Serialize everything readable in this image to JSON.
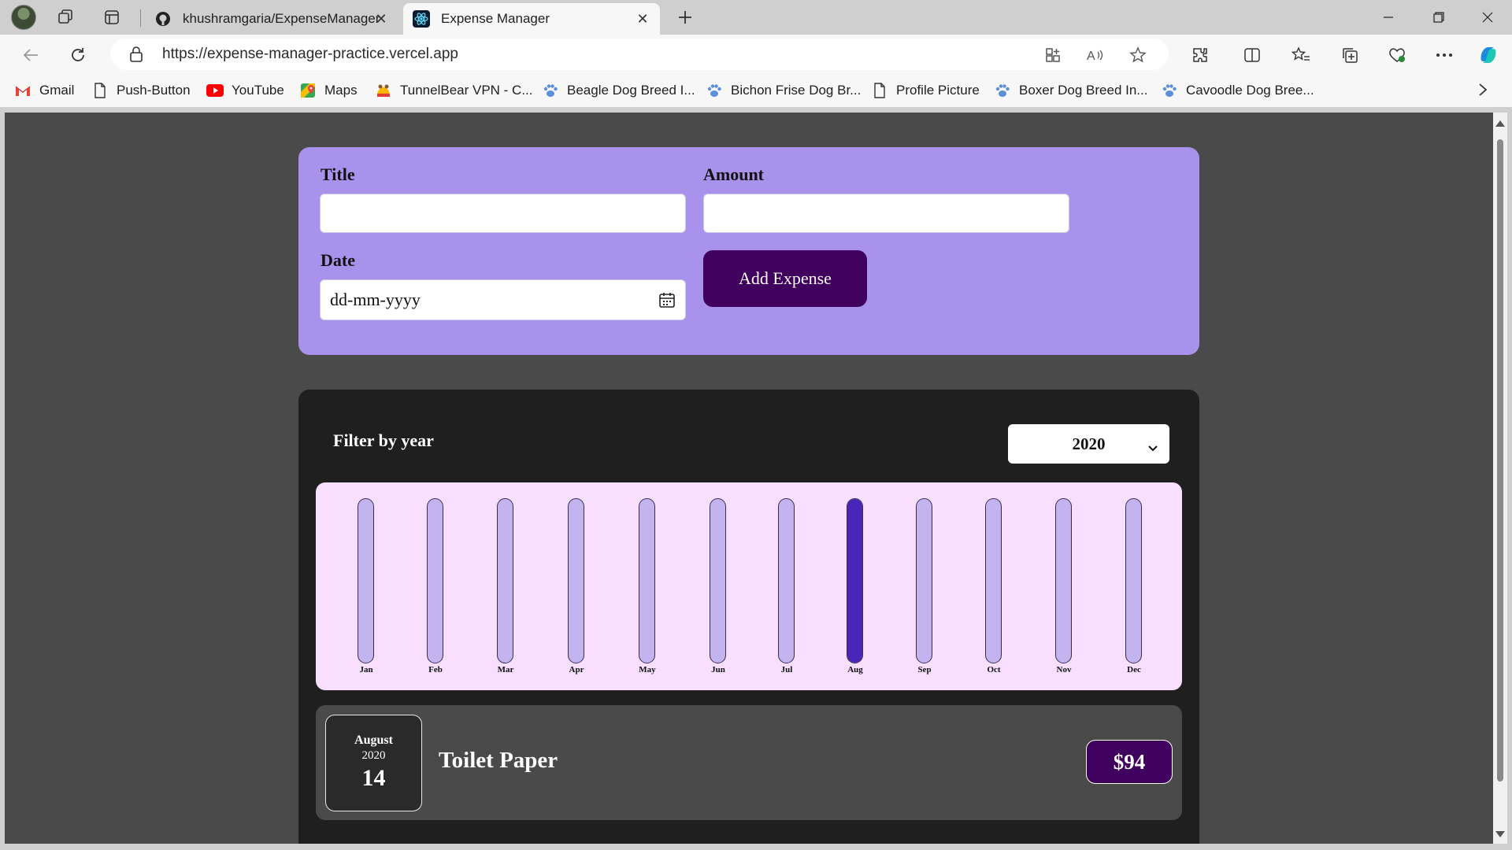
{
  "browser": {
    "tabs": [
      {
        "title": "khushramgaria/ExpenseManager",
        "active": false,
        "icon": "github-icon"
      },
      {
        "title": "Expense Manager",
        "active": true,
        "icon": "react-icon"
      }
    ],
    "url": "https://expense-manager-practice.vercel.app",
    "bookmarks": [
      {
        "label": "Gmail",
        "icon": "gmail-icon"
      },
      {
        "label": "Push-Button",
        "icon": "page-icon"
      },
      {
        "label": "YouTube",
        "icon": "youtube-icon"
      },
      {
        "label": "Maps",
        "icon": "maps-icon"
      },
      {
        "label": "TunnelBear VPN - C...",
        "icon": "tunnelbear-icon"
      },
      {
        "label": "Beagle Dog Breed I...",
        "icon": "paw-icon"
      },
      {
        "label": "Bichon Frise Dog Br...",
        "icon": "paw-icon"
      },
      {
        "label": "Profile Picture",
        "icon": "page-icon"
      },
      {
        "label": "Boxer Dog Breed In...",
        "icon": "paw-icon"
      },
      {
        "label": "Cavoodle Dog Bree...",
        "icon": "paw-icon"
      }
    ]
  },
  "form": {
    "title_label": "Title",
    "title_value": "",
    "amount_label": "Amount",
    "amount_value": "",
    "date_label": "Date",
    "date_placeholder": "dd-mm-yyyy",
    "submit_label": "Add Expense"
  },
  "filter": {
    "label": "Filter by year",
    "selected_year": "2020"
  },
  "chart_data": {
    "type": "bar",
    "categories": [
      "Jan",
      "Feb",
      "Mar",
      "Apr",
      "May",
      "Jun",
      "Jul",
      "Aug",
      "Sep",
      "Oct",
      "Nov",
      "Dec"
    ],
    "values": [
      0,
      0,
      0,
      0,
      0,
      0,
      0,
      1,
      0,
      0,
      0,
      0
    ],
    "ylim": [
      0,
      1
    ],
    "title": "",
    "xlabel": "",
    "ylabel": "",
    "grid": false,
    "colors": {
      "fill": "#4826b9",
      "track": "#c3b4f0",
      "background": "#f8dfff"
    }
  },
  "expenses": [
    {
      "month": "August",
      "year": "2020",
      "day": "14",
      "title": "Toilet Paper",
      "amount": "$94"
    }
  ],
  "colors": {
    "page_bg": "#4a4a4a",
    "form_bg": "#a892ec",
    "accent": "#40005d",
    "card_bg": "#1f1f1f"
  }
}
